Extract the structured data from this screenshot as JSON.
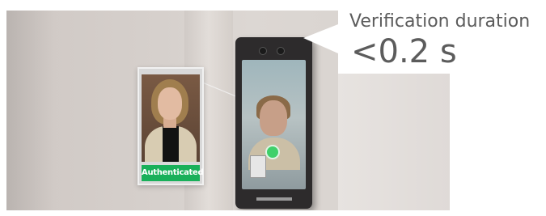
{
  "callout": {
    "title": "Verification duration",
    "value": "<0.2 s"
  },
  "auth_card": {
    "status_label": "Authenticated",
    "status_color": "#19b05a"
  },
  "device": {
    "indicator_color": "#3fd06a"
  }
}
